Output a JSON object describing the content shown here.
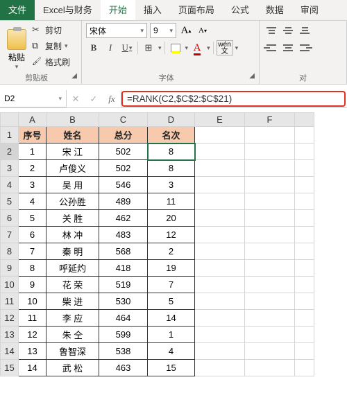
{
  "tabs": {
    "file": "文件",
    "custom": "Excel与财务",
    "home": "开始",
    "insert": "插入",
    "layout": "页面布局",
    "formulas": "公式",
    "data": "数据",
    "review": "审阅"
  },
  "clipboard": {
    "paste": "粘贴",
    "cut": "剪切",
    "copy": "复制",
    "format_painter": "格式刷",
    "group_label": "剪贴板"
  },
  "font": {
    "name": "宋体",
    "size": "9",
    "bold": "B",
    "italic": "I",
    "underline": "U",
    "group_label": "字体",
    "ruby": "wén"
  },
  "alignment": {
    "group_label": "对"
  },
  "formula_bar": {
    "name_box": "D2",
    "cancel": "✕",
    "enter": "✓",
    "fx": "fx",
    "formula": "=RANK(C2,$C$2:$C$21)"
  },
  "columns": [
    "A",
    "B",
    "C",
    "D",
    "E",
    "F"
  ],
  "row_numbers": [
    1,
    2,
    3,
    4,
    5,
    6,
    7,
    8,
    9,
    10,
    11,
    12,
    13,
    14,
    15
  ],
  "headers": {
    "A": "序号",
    "B": "姓名",
    "C": "总分",
    "D": "名次"
  },
  "rows": [
    {
      "n": "1",
      "name": "宋  江",
      "score": "502",
      "rank": "8"
    },
    {
      "n": "2",
      "name": "卢俊义",
      "score": "502",
      "rank": "8"
    },
    {
      "n": "3",
      "name": "吴  用",
      "score": "546",
      "rank": "3"
    },
    {
      "n": "4",
      "name": "公孙胜",
      "score": "489",
      "rank": "11"
    },
    {
      "n": "5",
      "name": "关  胜",
      "score": "462",
      "rank": "20"
    },
    {
      "n": "6",
      "name": "林  冲",
      "score": "483",
      "rank": "12"
    },
    {
      "n": "7",
      "name": "秦  明",
      "score": "568",
      "rank": "2"
    },
    {
      "n": "8",
      "name": "呼延灼",
      "score": "418",
      "rank": "19"
    },
    {
      "n": "9",
      "name": "花  荣",
      "score": "519",
      "rank": "7"
    },
    {
      "n": "10",
      "name": "柴  进",
      "score": "530",
      "rank": "5"
    },
    {
      "n": "11",
      "name": "李  应",
      "score": "464",
      "rank": "14"
    },
    {
      "n": "12",
      "name": "朱  仝",
      "score": "599",
      "rank": "1"
    },
    {
      "n": "13",
      "name": "鲁智深",
      "score": "538",
      "rank": "4"
    },
    {
      "n": "14",
      "name": "武  松",
      "score": "463",
      "rank": "15"
    }
  ]
}
